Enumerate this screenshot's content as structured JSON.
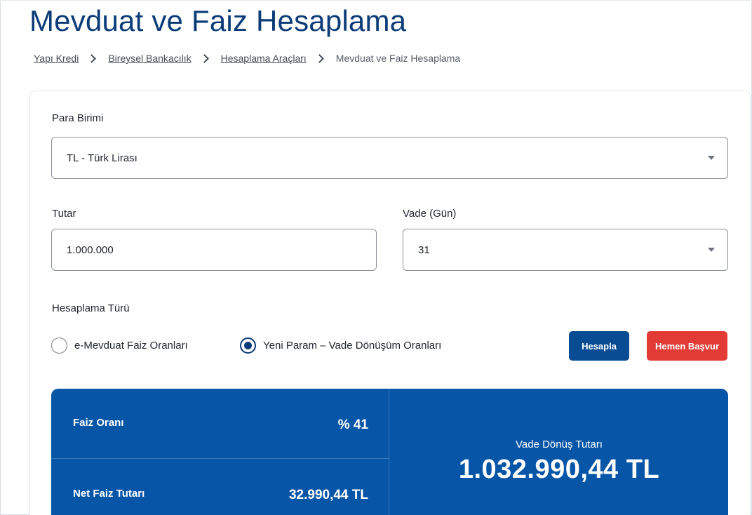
{
  "page": {
    "title": "Mevduat ve Faiz Hesaplama"
  },
  "breadcrumb": {
    "items": [
      "Yapı Kredi",
      "Bireysel Bankacılık",
      "Hesaplama Araçları"
    ],
    "current": "Mevduat ve Faiz Hesaplama"
  },
  "form": {
    "currency_label": "Para Birimi",
    "currency_value": "TL - Türk Lirası",
    "amount_label": "Tutar",
    "amount_value": "1.000.000",
    "term_label": "Vade (Gün)",
    "term_value": "31",
    "calc_type_label": "Hesaplama Türü",
    "radio_options": [
      {
        "label": "e-Mevduat Faiz Oranları",
        "checked": false
      },
      {
        "label": "Yeni Param – Vade Dönüşüm Oranları",
        "checked": true
      }
    ],
    "calculate_button": "Hesapla",
    "apply_button": "Hemen Başvur"
  },
  "result": {
    "rate_label": "Faiz Oranı",
    "rate_value": "% 41",
    "net_interest_label": "Net Faiz Tutarı",
    "net_interest_value": "32.990,44 TL",
    "maturity_label": "Vade Dönüş Tutarı",
    "maturity_value": "1.032.990,44 TL"
  },
  "colors": {
    "title": "#0b3c78",
    "result_bg": "#0755a6",
    "primary_button": "#0a4c94",
    "danger_button": "#e23b36"
  }
}
